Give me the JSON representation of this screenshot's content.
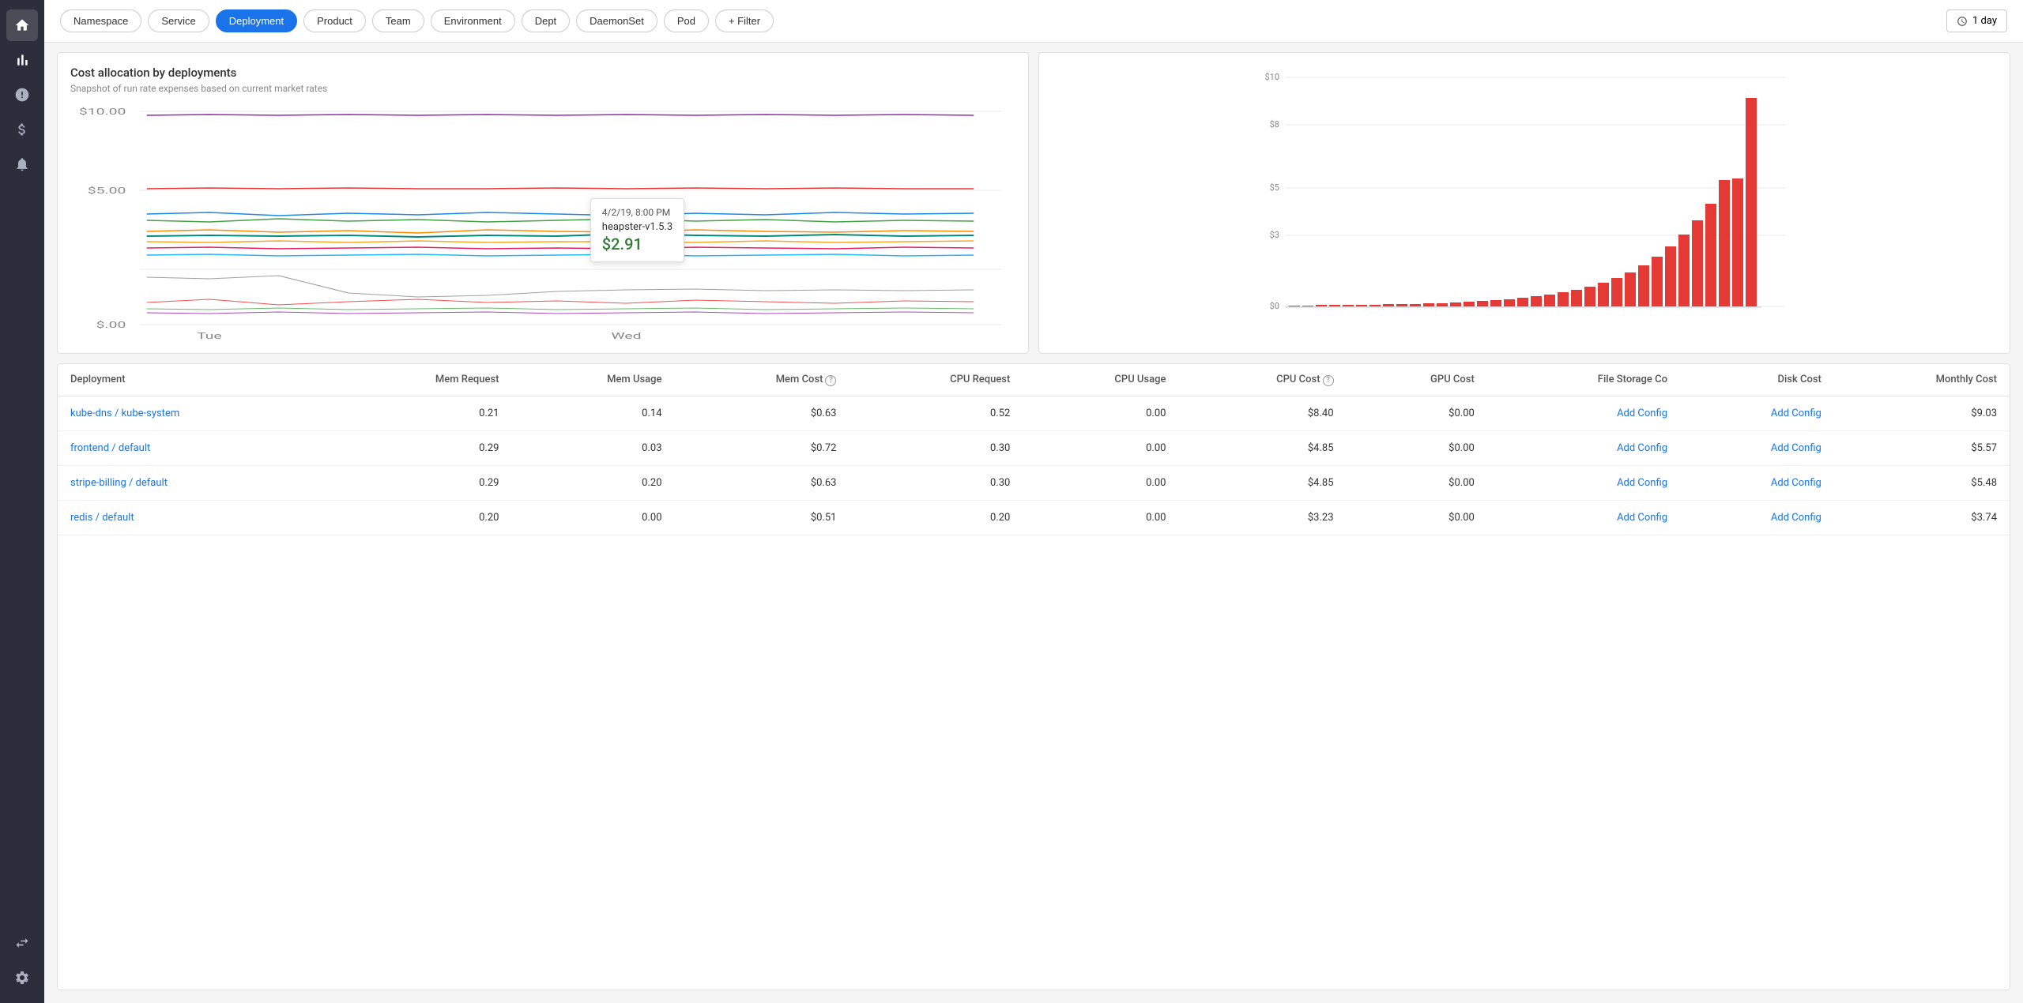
{
  "sidebar": {
    "icons": [
      {
        "name": "home-icon",
        "symbol": "⌂",
        "active": false
      },
      {
        "name": "chart-icon",
        "symbol": "▐",
        "active": true
      },
      {
        "name": "alert-icon",
        "symbol": "!",
        "active": false
      },
      {
        "name": "dollar-icon",
        "symbol": "$",
        "active": false
      },
      {
        "name": "bell-icon",
        "symbol": "🔔",
        "active": false
      },
      {
        "name": "transfer-icon",
        "symbol": "⇄",
        "active": false
      },
      {
        "name": "settings-icon",
        "symbol": "⚙",
        "active": false
      }
    ]
  },
  "filterBar": {
    "chips": [
      {
        "label": "Namespace",
        "active": false
      },
      {
        "label": "Service",
        "active": false
      },
      {
        "label": "Deployment",
        "active": true
      },
      {
        "label": "Product",
        "active": false
      },
      {
        "label": "Team",
        "active": false
      },
      {
        "label": "Environment",
        "active": false
      },
      {
        "label": "Dept",
        "active": false
      },
      {
        "label": "DaemonSet",
        "active": false
      },
      {
        "label": "Pod",
        "active": false
      }
    ],
    "addFilter": "+ Filter",
    "timeSelector": "1 day"
  },
  "lineChart": {
    "title": "Cost allocation by deployments",
    "subtitle": "Snapshot of run rate expenses based on current market rates",
    "yLabels": [
      "$10.00",
      "$5.00",
      "$.00"
    ],
    "xLabels": [
      "Tue",
      "Wed"
    ],
    "tooltip": {
      "date": "4/2/19, 8:00 PM",
      "label": "heapster-v1.5.3",
      "value": "$2.91"
    }
  },
  "barChart": {
    "yLabels": [
      "$10",
      "$8",
      "$5",
      "$3",
      "$0"
    ],
    "bars": [
      0.02,
      0.02,
      0.02,
      0.03,
      0.04,
      0.05,
      0.05,
      0.06,
      0.08,
      0.1,
      0.12,
      0.15,
      0.18,
      0.22,
      0.28,
      0.32,
      0.38,
      0.45,
      0.55,
      0.65,
      0.78,
      0.9,
      1.05,
      1.2,
      1.4,
      1.65,
      1.9,
      2.2,
      2.55,
      3.0,
      3.5,
      4.0,
      5.5,
      5.7,
      9.2
    ]
  },
  "table": {
    "headers": [
      {
        "label": "Deployment",
        "align": "left",
        "hasInfo": false
      },
      {
        "label": "Mem Request",
        "align": "right",
        "hasInfo": false
      },
      {
        "label": "Mem Usage",
        "align": "right",
        "hasInfo": false
      },
      {
        "label": "Mem Cost",
        "align": "right",
        "hasInfo": true
      },
      {
        "label": "CPU Request",
        "align": "right",
        "hasInfo": false
      },
      {
        "label": "CPU Usage",
        "align": "right",
        "hasInfo": false
      },
      {
        "label": "CPU Cost",
        "align": "right",
        "hasInfo": true
      },
      {
        "label": "GPU Cost",
        "align": "right",
        "hasInfo": false
      },
      {
        "label": "File Storage Co",
        "align": "right",
        "hasInfo": false
      },
      {
        "label": "Disk Cost",
        "align": "right",
        "hasInfo": false
      },
      {
        "label": "Monthly Cost",
        "align": "right",
        "hasInfo": false
      }
    ],
    "rows": [
      {
        "deployment": "kube-dns / kube-system",
        "memRequest": "0.21",
        "memUsage": "0.14",
        "memCost": "$0.63",
        "cpuRequest": "0.52",
        "cpuUsage": "0.00",
        "cpuCost": "$8.40",
        "gpuCost": "$0.00",
        "fileStorage": "Add Config",
        "diskCost": "Add Config",
        "monthlyCost": "$9.03"
      },
      {
        "deployment": "frontend / default",
        "memRequest": "0.29",
        "memUsage": "0.03",
        "memCost": "$0.72",
        "cpuRequest": "0.30",
        "cpuUsage": "0.00",
        "cpuCost": "$4.85",
        "gpuCost": "$0.00",
        "fileStorage": "Add Config",
        "diskCost": "Add Config",
        "monthlyCost": "$5.57"
      },
      {
        "deployment": "stripe-billing / default",
        "memRequest": "0.29",
        "memUsage": "0.20",
        "memCost": "$0.63",
        "cpuRequest": "0.30",
        "cpuUsage": "0.00",
        "cpuCost": "$4.85",
        "gpuCost": "$0.00",
        "fileStorage": "Add Config",
        "diskCost": "Add Config",
        "monthlyCost": "$5.48"
      },
      {
        "deployment": "redis / default",
        "memRequest": "0.20",
        "memUsage": "0.00",
        "memCost": "$0.51",
        "cpuRequest": "0.20",
        "cpuUsage": "0.00",
        "cpuCost": "$3.23",
        "gpuCost": "$0.00",
        "fileStorage": "Add Config",
        "diskCost": "Add Config",
        "monthlyCost": "$3.74"
      }
    ]
  }
}
